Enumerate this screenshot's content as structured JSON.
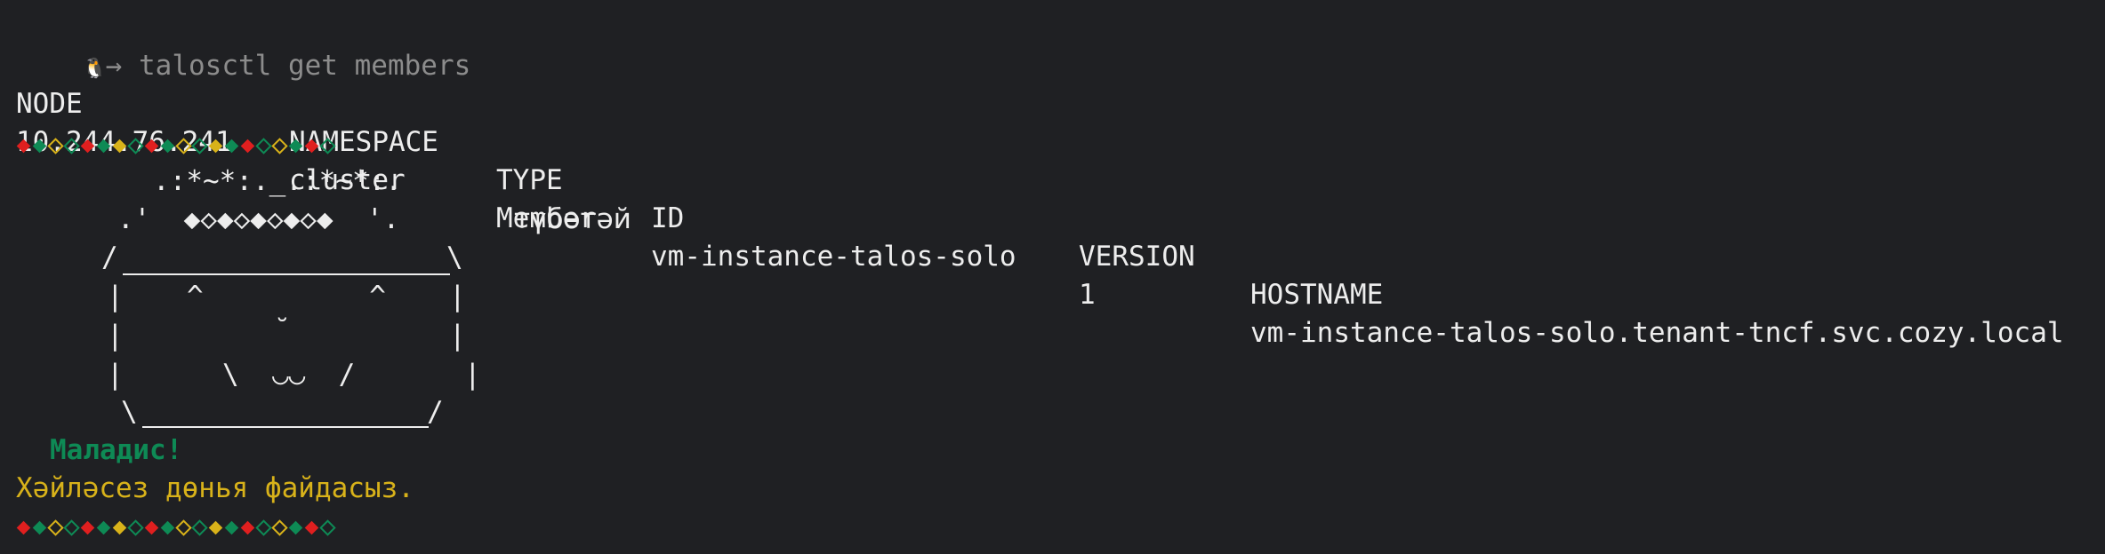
{
  "prompt": {
    "icon": "penguin-icon",
    "arrow": "→",
    "command": "talosctl get members"
  },
  "table": {
    "headers": [
      "NODE",
      "NAMESPACE",
      "TYPE",
      "ID",
      "VERSION",
      "HOSTNAME"
    ],
    "rows": [
      [
        "10.244.76.241",
        "cluster",
        "Member",
        "vm-instance-talos-solo",
        "1",
        "vm-instance-talos-solo.tenant-tncf.svc.cozy.local"
      ]
    ]
  },
  "diamond_colors": [
    "#e01f1f",
    "#0e8a55",
    "#ededed",
    "#d8b21a"
  ],
  "art": {
    "line_top": ".:*~*:._.:*~*:.",
    "line_hat": ".'  ◆◇◆◇◆◇◆◇◆  '.",
    "caption": "түбәтәй",
    "eyes": "^          ^",
    "nose": "˘",
    "mouth": "\\  ◡◡  /"
  },
  "messages": {
    "greeting": "Маладис!",
    "wish": "Хәйләсез дөнья файдасыз."
  },
  "colors": {
    "background": "#1f2023",
    "text": "#ededed",
    "muted": "#8c8c8c",
    "green": "#0e8a55",
    "yellow": "#d8b21a",
    "red": "#e01f1f"
  }
}
